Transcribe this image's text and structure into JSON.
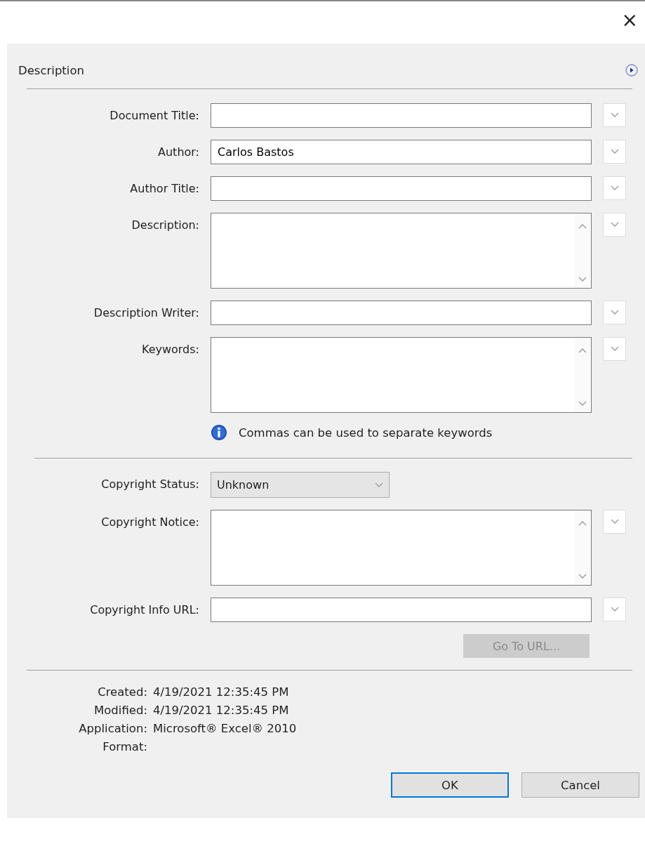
{
  "window": {
    "close": "×"
  },
  "section": {
    "title": "Description"
  },
  "fields": [
    {
      "kind": "text",
      "label": "Document Title:",
      "has_menu": true
    },
    {
      "kind": "text",
      "label": "Author:",
      "value": "Carlos Bastos",
      "has_menu": true
    },
    {
      "kind": "text",
      "label": "Author Title:",
      "has_menu": true
    },
    {
      "kind": "textarea",
      "label": "Description:",
      "has_menu": true
    },
    {
      "kind": "text",
      "label": "Description Writer:",
      "has_menu": true
    },
    {
      "kind": "textarea",
      "label": "Keywords:",
      "has_menu": true
    },
    {
      "kind": "info",
      "text": "Commas can be used to separate keywords"
    },
    {
      "kind": "divider"
    },
    {
      "kind": "select",
      "label": "Copyright Status:",
      "value": "Unknown",
      "has_menu": false
    },
    {
      "kind": "textarea",
      "label": "Copyright Notice:",
      "has_menu": true
    },
    {
      "kind": "text",
      "label": "Copyright Info URL:",
      "has_menu": true
    },
    {
      "kind": "button",
      "text": "Go To URL...",
      "disabled": true
    }
  ],
  "meta": [
    {
      "label": "Created:",
      "value": "4/19/2021 12:35:45 PM"
    },
    {
      "label": "Modified:",
      "value": "4/19/2021 12:35:45 PM"
    },
    {
      "label": "Application:",
      "value": "Microsoft® Excel® 2010"
    },
    {
      "label": "Format:"
    }
  ],
  "buttons": [
    {
      "text": "OK",
      "default": true
    },
    {
      "text": "Cancel",
      "default": false
    }
  ]
}
